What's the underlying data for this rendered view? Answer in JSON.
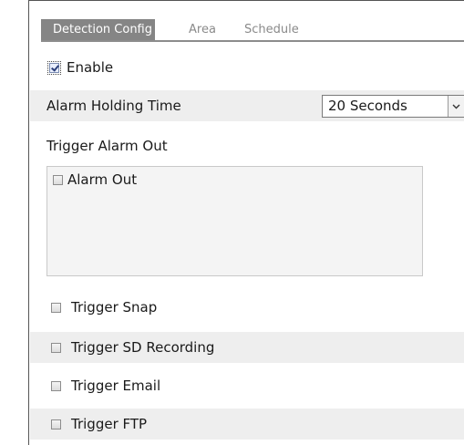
{
  "tabs": {
    "detection_config": "Detection Config",
    "area": "Area",
    "schedule": "Schedule"
  },
  "enable": {
    "label": "Enable",
    "checked": true
  },
  "alarm_holding_time": {
    "label": "Alarm Holding Time",
    "selected": "20 Seconds"
  },
  "trigger_alarm_out": {
    "label": "Trigger Alarm Out",
    "alarm_out_label": "Alarm Out"
  },
  "triggers": {
    "snap": "Trigger Snap",
    "sd_recording": "Trigger SD Recording",
    "email": "Trigger Email",
    "ftp": "Trigger FTP"
  },
  "colors": {
    "active_tab_bg": "#858585",
    "shaded_row_bg": "#eeeeee",
    "inactive_tab_text": "#8a8a8a"
  },
  "icons": {
    "select_arrow": "chevron-down-icon",
    "checkbox_checked": "checkbox-checked-icon",
    "checkbox_unchecked": "checkbox-icon"
  }
}
